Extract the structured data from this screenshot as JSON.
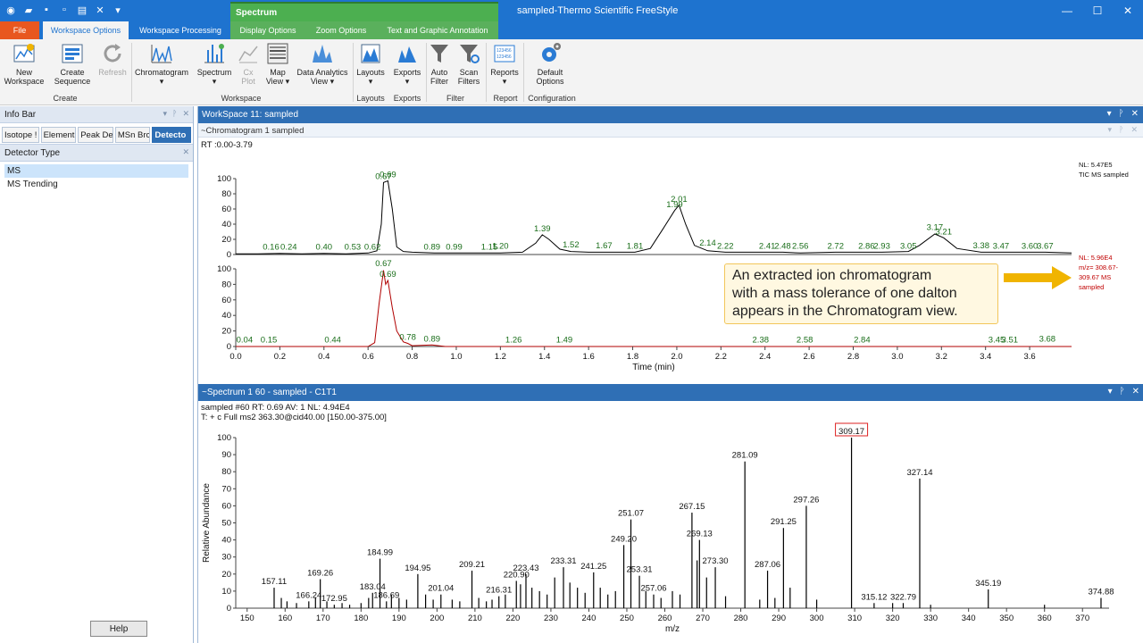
{
  "window": {
    "title": "sampled-Thermo Scientific FreeStyle",
    "context_tab": "Spectrum"
  },
  "ribbon_tabs": [
    {
      "label": "File"
    },
    {
      "label": "Workspace Options"
    },
    {
      "label": "Workspace Processing"
    },
    {
      "label": "Display Options"
    },
    {
      "label": "Zoom Options"
    },
    {
      "label": "Text and Graphic Annotation"
    }
  ],
  "ribbon": {
    "buttons": [
      {
        "label1": "New",
        "label2": "Workspace"
      },
      {
        "label1": "Create",
        "label2": "Sequence"
      },
      {
        "label1": "Refresh",
        "label2": ""
      },
      {
        "label1": "Chromatogram",
        "label2": "▾"
      },
      {
        "label1": "Spectrum",
        "label2": "▾"
      },
      {
        "label1": "Cx",
        "label2": "Plot"
      },
      {
        "label1": "Map",
        "label2": "View ▾"
      },
      {
        "label1": "Data Analytics",
        "label2": "View ▾"
      },
      {
        "label1": "Layouts",
        "label2": "▾"
      },
      {
        "label1": "Exports",
        "label2": "▾"
      },
      {
        "label1": "Auto",
        "label2": "Filter"
      },
      {
        "label1": "Scan",
        "label2": "Filters"
      },
      {
        "label1": "Reports",
        "label2": "▾"
      },
      {
        "label1": "Default",
        "label2": "Options"
      }
    ],
    "groups": [
      "Create",
      "Workspace",
      "Layouts",
      "Exports",
      "Filter",
      "Report",
      "Configuration"
    ]
  },
  "infobar": {
    "title": "Info Bar",
    "tabs": [
      "Isotope !",
      "Element",
      "Peak De",
      "MSn Brc",
      "Detecto"
    ],
    "section_title": "Detector Type",
    "items": [
      "MS",
      "MS Trending"
    ],
    "help_label": "Help"
  },
  "workspace": {
    "title": "WorkSpace 11: sampled",
    "chromatogram_header": "~Chromatogram  1  sampled",
    "spectrum_header": "~Spectrum  1  60 - sampled - C1T1"
  },
  "callout": {
    "line1": "An extracted ion chromatogram",
    "line2": "with a mass tolerance of one dalton",
    "line3": "appears in the Chromatogram view."
  },
  "chart_data": [
    {
      "type": "line",
      "title": "TIC",
      "range_label": "RT :0.00-3.79",
      "info": [
        "NL: 5.47E5",
        "TIC  MS  sampled"
      ],
      "xlabel": "Time (min)",
      "ylim": [
        0,
        100
      ],
      "xlim": [
        0,
        3.79
      ],
      "x_ticks": [
        0.0,
        0.2,
        0.4,
        0.6,
        0.8,
        1.0,
        1.2,
        1.4,
        1.6,
        1.8,
        2.0,
        2.2,
        2.4,
        2.6,
        2.8,
        3.0,
        3.2,
        3.4,
        3.6
      ],
      "y_ticks": [
        0,
        20,
        40,
        60,
        80,
        100
      ],
      "points": [
        [
          0,
          1
        ],
        [
          0.1,
          1
        ],
        [
          0.2,
          1.5
        ],
        [
          0.3,
          1
        ],
        [
          0.4,
          1.5
        ],
        [
          0.5,
          1
        ],
        [
          0.6,
          2
        ],
        [
          0.64,
          5
        ],
        [
          0.66,
          40
        ],
        [
          0.67,
          95
        ],
        [
          0.69,
          97
        ],
        [
          0.71,
          60
        ],
        [
          0.73,
          10
        ],
        [
          0.76,
          4
        ],
        [
          0.8,
          3
        ],
        [
          0.9,
          2
        ],
        [
          1.0,
          2
        ],
        [
          1.1,
          2
        ],
        [
          1.2,
          2
        ],
        [
          1.3,
          3
        ],
        [
          1.36,
          15
        ],
        [
          1.39,
          26
        ],
        [
          1.42,
          20
        ],
        [
          1.47,
          7
        ],
        [
          1.52,
          4
        ],
        [
          1.6,
          3
        ],
        [
          1.67,
          3
        ],
        [
          1.75,
          3
        ],
        [
          1.81,
          3
        ],
        [
          1.88,
          8
        ],
        [
          1.94,
          35
        ],
        [
          1.99,
          58
        ],
        [
          2.01,
          65
        ],
        [
          2.04,
          40
        ],
        [
          2.08,
          12
        ],
        [
          2.14,
          5
        ],
        [
          2.22,
          3
        ],
        [
          2.3,
          3
        ],
        [
          2.41,
          3
        ],
        [
          2.48,
          3
        ],
        [
          2.56,
          2
        ],
        [
          2.72,
          3
        ],
        [
          2.86,
          3
        ],
        [
          2.93,
          3
        ],
        [
          3.05,
          4
        ],
        [
          3.1,
          12
        ],
        [
          3.17,
          27
        ],
        [
          3.21,
          22
        ],
        [
          3.27,
          8
        ],
        [
          3.38,
          3
        ],
        [
          3.47,
          3
        ],
        [
          3.6,
          3
        ],
        [
          3.67,
          3
        ],
        [
          3.79,
          2
        ]
      ],
      "peak_labels": [
        {
          "x": 0.16,
          "y": 3,
          "t": "0.16"
        },
        {
          "x": 0.24,
          "y": 3,
          "t": "0.24"
        },
        {
          "x": 0.4,
          "y": 3,
          "t": "0.40"
        },
        {
          "x": 0.53,
          "y": 3,
          "t": "0.53"
        },
        {
          "x": 0.62,
          "y": 3,
          "t": "0.62"
        },
        {
          "x": 0.67,
          "y": 96,
          "t": "0.67"
        },
        {
          "x": 0.69,
          "y": 98,
          "t": "0.69"
        },
        {
          "x": 0.89,
          "y": 3,
          "t": "0.89"
        },
        {
          "x": 0.99,
          "y": 3,
          "t": "0.99"
        },
        {
          "x": 1.15,
          "y": 3,
          "t": "1.15"
        },
        {
          "x": 1.2,
          "y": 4,
          "t": "1.20"
        },
        {
          "x": 1.39,
          "y": 27,
          "t": "1.39"
        },
        {
          "x": 1.52,
          "y": 6,
          "t": "1.52"
        },
        {
          "x": 1.67,
          "y": 5,
          "t": "1.67"
        },
        {
          "x": 1.81,
          "y": 4,
          "t": "1.81"
        },
        {
          "x": 1.99,
          "y": 59,
          "t": "1.99"
        },
        {
          "x": 2.01,
          "y": 66,
          "t": "2.01"
        },
        {
          "x": 2.14,
          "y": 8,
          "t": "2.14"
        },
        {
          "x": 2.22,
          "y": 4,
          "t": "2.22"
        },
        {
          "x": 2.41,
          "y": 4,
          "t": "2.41"
        },
        {
          "x": 2.48,
          "y": 4,
          "t": "2.48"
        },
        {
          "x": 2.56,
          "y": 4,
          "t": "2.56"
        },
        {
          "x": 2.72,
          "y": 4,
          "t": "2.72"
        },
        {
          "x": 2.86,
          "y": 4,
          "t": "2.86"
        },
        {
          "x": 2.93,
          "y": 4,
          "t": "2.93"
        },
        {
          "x": 3.05,
          "y": 4,
          "t": "3.05"
        },
        {
          "x": 3.17,
          "y": 29,
          "t": "3.17"
        },
        {
          "x": 3.21,
          "y": 23,
          "t": "3.21"
        },
        {
          "x": 3.38,
          "y": 5,
          "t": "3.38"
        },
        {
          "x": 3.47,
          "y": 4,
          "t": "3.47"
        },
        {
          "x": 3.6,
          "y": 4,
          "t": "3.60"
        },
        {
          "x": 3.67,
          "y": 4,
          "t": "3.67"
        }
      ]
    },
    {
      "type": "line",
      "title": "XIC",
      "info": [
        "NL: 5.96E4",
        "m/z= 308.67-",
        "309.67 MS",
        "sampled"
      ],
      "xlabel": "Time (min)",
      "ylim": [
        0,
        100
      ],
      "xlim": [
        0,
        3.79
      ],
      "x_ticks": [
        0.0,
        0.2,
        0.4,
        0.6,
        0.8,
        1.0,
        1.2,
        1.4,
        1.6,
        1.8,
        2.0,
        2.2,
        2.4,
        2.6,
        2.8,
        3.0,
        3.2,
        3.4,
        3.6
      ],
      "y_ticks": [
        0,
        20,
        40,
        60,
        80,
        100
      ],
      "points": [
        [
          0,
          0
        ],
        [
          0.6,
          0
        ],
        [
          0.63,
          5
        ],
        [
          0.65,
          55
        ],
        [
          0.67,
          98
        ],
        [
          0.68,
          80
        ],
        [
          0.69,
          85
        ],
        [
          0.71,
          50
        ],
        [
          0.73,
          20
        ],
        [
          0.76,
          6
        ],
        [
          0.78,
          4
        ],
        [
          0.8,
          1
        ],
        [
          0.89,
          2
        ],
        [
          0.95,
          0
        ],
        [
          3.79,
          0
        ]
      ],
      "peak_labels": [
        {
          "x": 0.04,
          "y": 2,
          "t": "0.04"
        },
        {
          "x": 0.15,
          "y": 2,
          "t": "0.15"
        },
        {
          "x": 0.44,
          "y": 2,
          "t": "0.44"
        },
        {
          "x": 0.67,
          "y": 100,
          "t": "0.67"
        },
        {
          "x": 0.69,
          "y": 86,
          "t": "0.69"
        },
        {
          "x": 0.78,
          "y": 5,
          "t": "0.78"
        },
        {
          "x": 0.89,
          "y": 3,
          "t": "0.89"
        },
        {
          "x": 1.26,
          "y": 2,
          "t": "1.26"
        },
        {
          "x": 1.49,
          "y": 2,
          "t": "1.49"
        },
        {
          "x": 2.38,
          "y": 2,
          "t": "2.38"
        },
        {
          "x": 2.58,
          "y": 2,
          "t": "2.58"
        },
        {
          "x": 2.84,
          "y": 2,
          "t": "2.84"
        },
        {
          "x": 3.45,
          "y": 2,
          "t": "3.45"
        },
        {
          "x": 3.51,
          "y": 2,
          "t": "3.51"
        },
        {
          "x": 3.68,
          "y": 3,
          "t": "3.68"
        }
      ]
    },
    {
      "type": "bar",
      "title": "Spectrum",
      "scan_info": "sampled #60 RT: 0.69 AV: 1 NL: 4.94E4",
      "filter": "T: + c Full ms2 363.30@cid40.00 [150.00-375.00]",
      "xlabel": "m/z",
      "ylabel": "Relative Abundance",
      "xlim": [
        147,
        377
      ],
      "ylim": [
        0,
        100
      ],
      "x_ticks": [
        150,
        160,
        170,
        180,
        190,
        200,
        210,
        220,
        230,
        240,
        250,
        260,
        270,
        280,
        290,
        300,
        310,
        320,
        330,
        340,
        350,
        360,
        370
      ],
      "y_ticks": [
        0,
        10,
        20,
        30,
        40,
        50,
        60,
        70,
        80,
        90,
        100
      ],
      "highlight": "309.17",
      "peaks": [
        [
          157.11,
          12
        ],
        [
          159,
          6
        ],
        [
          160.5,
          4
        ],
        [
          163,
          3
        ],
        [
          166.24,
          4
        ],
        [
          168,
          6
        ],
        [
          169.26,
          17
        ],
        [
          171,
          4
        ],
        [
          172.95,
          2
        ],
        [
          175,
          3
        ],
        [
          177,
          2
        ],
        [
          180,
          3
        ],
        [
          182,
          6
        ],
        [
          183.04,
          9
        ],
        [
          184.99,
          29
        ],
        [
          186.69,
          4
        ],
        [
          188,
          8
        ],
        [
          190,
          6
        ],
        [
          192,
          5
        ],
        [
          194.95,
          20
        ],
        [
          197,
          8
        ],
        [
          199,
          5
        ],
        [
          201.04,
          8
        ],
        [
          204,
          5
        ],
        [
          206,
          4
        ],
        [
          209.21,
          22
        ],
        [
          211,
          6
        ],
        [
          213,
          4
        ],
        [
          214.5,
          5
        ],
        [
          216.31,
          7
        ],
        [
          218,
          8
        ],
        [
          220.9,
          16
        ],
        [
          222,
          14
        ],
        [
          223.43,
          20
        ],
        [
          225,
          12
        ],
        [
          227,
          10
        ],
        [
          229,
          8
        ],
        [
          231,
          18
        ],
        [
          233.31,
          24
        ],
        [
          235,
          15
        ],
        [
          237,
          12
        ],
        [
          239,
          9
        ],
        [
          241.25,
          21
        ],
        [
          243,
          12
        ],
        [
          245,
          8
        ],
        [
          247,
          10
        ],
        [
          249.2,
          37
        ],
        [
          251.07,
          52
        ],
        [
          253.31,
          19
        ],
        [
          255,
          10
        ],
        [
          257.06,
          8
        ],
        [
          259,
          6
        ],
        [
          262,
          10
        ],
        [
          264,
          8
        ],
        [
          267.15,
          56
        ],
        [
          268.5,
          28
        ],
        [
          269.13,
          40
        ],
        [
          271,
          18
        ],
        [
          273.3,
          24
        ],
        [
          276,
          7
        ],
        [
          281.09,
          86
        ],
        [
          285,
          5
        ],
        [
          287.06,
          22
        ],
        [
          289,
          6
        ],
        [
          291.25,
          47
        ],
        [
          293,
          12
        ],
        [
          297.26,
          60
        ],
        [
          300,
          5
        ],
        [
          309.17,
          100
        ],
        [
          315.12,
          3
        ],
        [
          320,
          3
        ],
        [
          322.79,
          3
        ],
        [
          327.14,
          76
        ],
        [
          330,
          2
        ],
        [
          345.19,
          11
        ],
        [
          360,
          2
        ],
        [
          374.88,
          6
        ]
      ],
      "labels": [
        [
          157.11,
          "157.11"
        ],
        [
          166.24,
          "166.24"
        ],
        [
          169.26,
          "169.26"
        ],
        [
          172.95,
          "172.95"
        ],
        [
          183.04,
          "183.04"
        ],
        [
          184.99,
          "184.99"
        ],
        [
          186.69,
          "186.69"
        ],
        [
          194.95,
          "194.95"
        ],
        [
          201.04,
          "201.04"
        ],
        [
          209.21,
          "209.21"
        ],
        [
          216.31,
          "216.31"
        ],
        [
          220.9,
          "220.90"
        ],
        [
          223.43,
          "223.43"
        ],
        [
          233.31,
          "233.31"
        ],
        [
          241.25,
          "241.25"
        ],
        [
          249.2,
          "249.20"
        ],
        [
          251.07,
          "251.07"
        ],
        [
          253.31,
          "253.31"
        ],
        [
          257.06,
          "257.06"
        ],
        [
          267.15,
          "267.15"
        ],
        [
          269.13,
          "269.13"
        ],
        [
          273.3,
          "273.30"
        ],
        [
          281.09,
          "281.09"
        ],
        [
          287.06,
          "287.06"
        ],
        [
          291.25,
          "291.25"
        ],
        [
          297.26,
          "297.26"
        ],
        [
          309.17,
          "309.17"
        ],
        [
          315.12,
          "315.12"
        ],
        [
          322.79,
          "322.79"
        ],
        [
          327.14,
          "327.14"
        ],
        [
          345.19,
          "345.19"
        ],
        [
          374.88,
          "374.88"
        ]
      ]
    }
  ],
  "colors": {
    "titlebar": "#1e73cf",
    "file_tab": "#e8571f",
    "context": "#4caf50",
    "trace_tic": "#000000",
    "trace_xic": "#b00000",
    "label_green": "#1a6e1a",
    "info_red": "#c00000"
  }
}
